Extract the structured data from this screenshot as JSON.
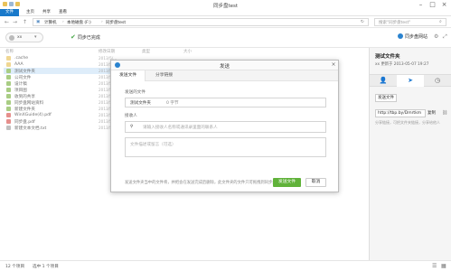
{
  "window": {
    "title": "同步盘test"
  },
  "ribbon": {
    "tabs": [
      "文件",
      "主页",
      "共享",
      "查看"
    ]
  },
  "address": {
    "crumbs": [
      "计算机",
      "本地磁盘 (F:)",
      "同步盘test"
    ],
    "search_placeholder": "搜索\"同步盘test\""
  },
  "toolbar": {
    "user": "xx",
    "sync_status": "同步已完成",
    "sync_home": "同步盘网站"
  },
  "list": {
    "header_name": "名称",
    "header_date": "修改日期",
    "header_type": "类型",
    "header_size": "大小",
    "items": [
      {
        "name": ".cache",
        "date": "2013/5/...",
        "kind": "folder"
      },
      {
        "name": "AAA",
        "date": "2013/5/...",
        "kind": "folder"
      },
      {
        "name": "测试文件夹",
        "date": "2013/5/...",
        "kind": "shared",
        "selected": true
      },
      {
        "name": "公司文件",
        "date": "2013/5/...",
        "kind": "shared"
      },
      {
        "name": "设计稿",
        "date": "2013/5/...",
        "kind": "shared"
      },
      {
        "name": "项目图",
        "date": "2013/5/...",
        "kind": "shared"
      },
      {
        "name": "收到的共享",
        "date": "2013/5/...",
        "kind": "shared"
      },
      {
        "name": "同步盘网站资料",
        "date": "2013/5/...",
        "kind": "shared"
      },
      {
        "name": "新建文件夹",
        "date": "2013/5/...",
        "kind": "shared"
      },
      {
        "name": "WinXGuide(4).pdf",
        "date": "2013/5/...",
        "kind": "pdf"
      },
      {
        "name": "同步盘.pdf",
        "date": "2013/5/...",
        "kind": "pdf"
      },
      {
        "name": "新建文本文档.txt",
        "date": "2013/5/...",
        "kind": "txt"
      }
    ]
  },
  "side": {
    "name": "测试文件夹",
    "date": "xx 更新于 2013-05-07 19:27",
    "send_button": "发送文件",
    "link": "http://tbp.by/Dmrtkm",
    "copy": "复制",
    "link_hint": "分享链接，可把文件夹链接，分享给他人"
  },
  "status": {
    "count": "12 个项目",
    "selected": "选中 1 个项目"
  },
  "dialog": {
    "title": "发送",
    "tabs": [
      "发送文件",
      "分享链接"
    ],
    "folder_label": "发送的文件",
    "folder_value": "测试文件夹",
    "folder_size": "0 字节",
    "recipient_label": "接收人",
    "recipient_placeholder": "请输入接收人名称或通讯录里面的联系人",
    "message_placeholder": "文件描述或留言（可选）",
    "hint": "发送文件夹当中的文件将，并把会在发送完成后删除，此文件夹的文件只可拖拽到同步盘",
    "send_button": "发送文件",
    "cancel_button": "取消"
  },
  "colors": {
    "accent": "#1979ca",
    "send_green": "#60b23a",
    "selection": "#cce4f7"
  }
}
